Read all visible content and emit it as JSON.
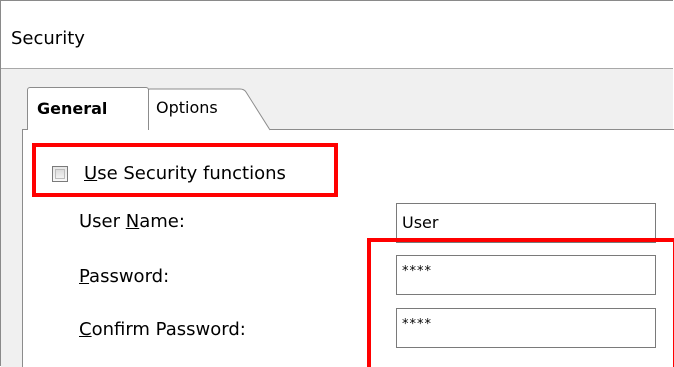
{
  "window": {
    "title": "Security"
  },
  "tabs": [
    {
      "label": "General",
      "active": true
    },
    {
      "label": "Options",
      "active": false
    }
  ],
  "security_checkbox": {
    "label_mnemonic": "U",
    "label_rest": "se Security functions",
    "checked": false
  },
  "fields": {
    "username": {
      "label_pre": "User ",
      "label_mnemonic": "N",
      "label_post": "ame:",
      "value": "User"
    },
    "password": {
      "label_mnemonic": "P",
      "label_post": "assword:",
      "value": "****"
    },
    "confirm_password": {
      "label_mnemonic": "C",
      "label_post": "onfirm Password:",
      "value": "****"
    }
  },
  "highlight_color": "#ff0000"
}
